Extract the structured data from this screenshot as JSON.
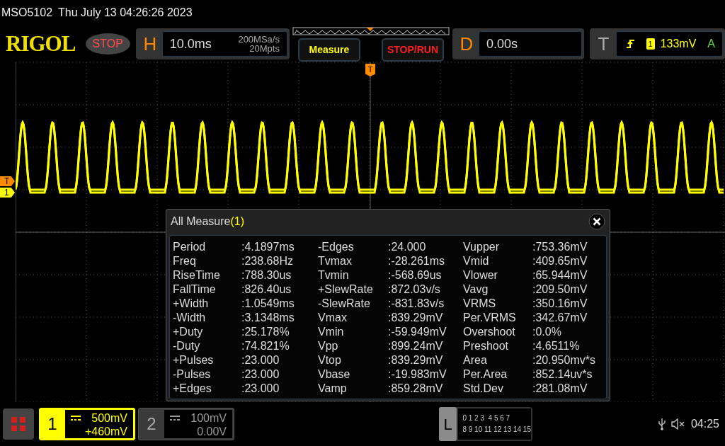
{
  "status_line": {
    "model": "MSO5102",
    "datetime": "Thu July 13 04:26:26 2023"
  },
  "logo": "RIGOL",
  "run_state": "STOP",
  "horizontal": {
    "letter": "H",
    "timebase": "10.0ms",
    "sample_rate": "200MSa/s",
    "memory_depth": "20Mpts"
  },
  "buttons": [
    {
      "label": "Measure",
      "kind": "measure"
    },
    {
      "label": "STOP/RUN",
      "kind": "stoprun"
    }
  ],
  "delay": {
    "letter": "D",
    "value": "0.00s"
  },
  "trigger": {
    "letter": "T",
    "source": "1",
    "level": "133mV",
    "mode": "A"
  },
  "top_trigger_marker": "T",
  "side_markers": [
    {
      "label": "T",
      "kind": "trigger"
    },
    {
      "label": "1",
      "kind": "channel"
    }
  ],
  "measure_panel": {
    "title": "All Measure",
    "count": "(1)",
    "rows": [
      [
        {
          "label": "Period",
          "value": ":4.1897ms"
        },
        {
          "label": "-Edges",
          "value": ":24.000"
        },
        {
          "label": "Vupper",
          "value": ":753.36mV"
        }
      ],
      [
        {
          "label": "Freq",
          "value": ":238.68Hz"
        },
        {
          "label": "Tvmax",
          "value": ":-28.261ms"
        },
        {
          "label": "Vmid",
          "value": ":409.65mV"
        }
      ],
      [
        {
          "label": "RiseTime",
          "value": ":788.30us"
        },
        {
          "label": "Tvmin",
          "value": ":-568.69us"
        },
        {
          "label": "Vlower",
          "value": ":65.944mV"
        }
      ],
      [
        {
          "label": "FallTime",
          "value": ":826.40us"
        },
        {
          "label": "+SlewRate",
          "value": ":872.03v/s"
        },
        {
          "label": "Vavg",
          "value": ":209.50mV"
        }
      ],
      [
        {
          "label": "+Width",
          "value": ":1.0549ms"
        },
        {
          "label": "-SlewRate",
          "value": ":-831.83v/s"
        },
        {
          "label": "VRMS",
          "value": ":350.16mV"
        }
      ],
      [
        {
          "label": "-Width",
          "value": ":3.1348ms"
        },
        {
          "label": "Vmax",
          "value": ":839.29mV"
        },
        {
          "label": "Per.VRMS",
          "value": ":342.67mV"
        }
      ],
      [
        {
          "label": "+Duty",
          "value": ":25.178%"
        },
        {
          "label": "Vmin",
          "value": ":-59.949mV"
        },
        {
          "label": "Overshoot",
          "value": ":0.0%"
        }
      ],
      [
        {
          "label": "-Duty",
          "value": ":74.821%"
        },
        {
          "label": "Vpp",
          "value": ":899.24mV"
        },
        {
          "label": "Preshoot",
          "value": ":4.6511%"
        }
      ],
      [
        {
          "label": "+Pulses",
          "value": ":23.000"
        },
        {
          "label": "Vtop",
          "value": ":839.29mV"
        },
        {
          "label": "Area",
          "value": ":20.950mv*s"
        }
      ],
      [
        {
          "label": "-Pulses",
          "value": ":23.000"
        },
        {
          "label": "Vbase",
          "value": ":-19.983mV"
        },
        {
          "label": "Per.Area",
          "value": ":852.14uv*s"
        }
      ],
      [
        {
          "label": "+Edges",
          "value": ":23.000"
        },
        {
          "label": "Vamp",
          "value": ":859.28mV"
        },
        {
          "label": "Std.Dev",
          "value": ":281.08mV"
        }
      ]
    ]
  },
  "channels": [
    {
      "number": "1",
      "scale": "500mV",
      "offset": "+460mV",
      "on": true
    },
    {
      "number": "2",
      "scale": "100mV",
      "offset": "0.00V",
      "on": false
    }
  ],
  "logic": {
    "letter": "L",
    "bits_top": "0 1 2 3  4 5 6 7",
    "bits_bottom": "8 9 10 11 12 13 14 15"
  },
  "clock": "04:25"
}
